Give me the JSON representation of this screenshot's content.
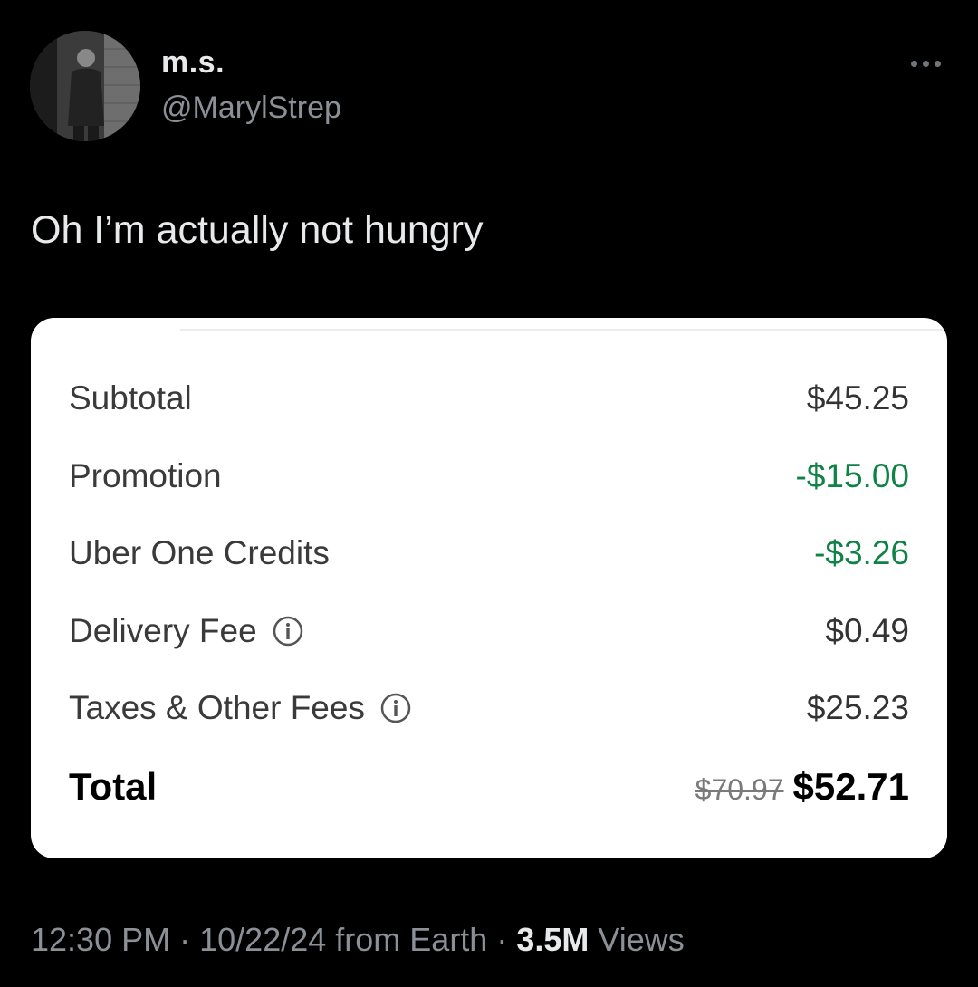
{
  "author": {
    "display_name": "m.s.",
    "handle": "@MarylStrep",
    "avatar_icon": "grayscale-person-photo"
  },
  "tweet": {
    "text": "Oh I’m actually not hungry"
  },
  "receipt": {
    "rows": [
      {
        "label": "Subtotal",
        "value": "$45.25",
        "type": "normal"
      },
      {
        "label": "Promotion",
        "value": "-$15.00",
        "type": "discount"
      },
      {
        "label": "Uber One Credits",
        "value": "-$3.26",
        "type": "discount"
      },
      {
        "label": "Delivery Fee",
        "value": "$0.49",
        "type": "normal",
        "info_icon": true
      },
      {
        "label": "Taxes & Other Fees",
        "value": "$25.23",
        "type": "normal",
        "info_icon": true
      }
    ],
    "total": {
      "label": "Total",
      "original_value": "$70.97",
      "final_value": "$52.71"
    },
    "colors": {
      "discount": "#0e8345",
      "card_background": "#ffffff"
    }
  },
  "meta": {
    "time": "12:30 PM",
    "separator": "·",
    "date": "10/22/24",
    "source": "from Earth",
    "views_count": "3.5M",
    "views_label": "Views"
  },
  "theme": {
    "background": "#000000",
    "primary_text": "#e7e9ea",
    "secondary_text": "#8b9096"
  }
}
